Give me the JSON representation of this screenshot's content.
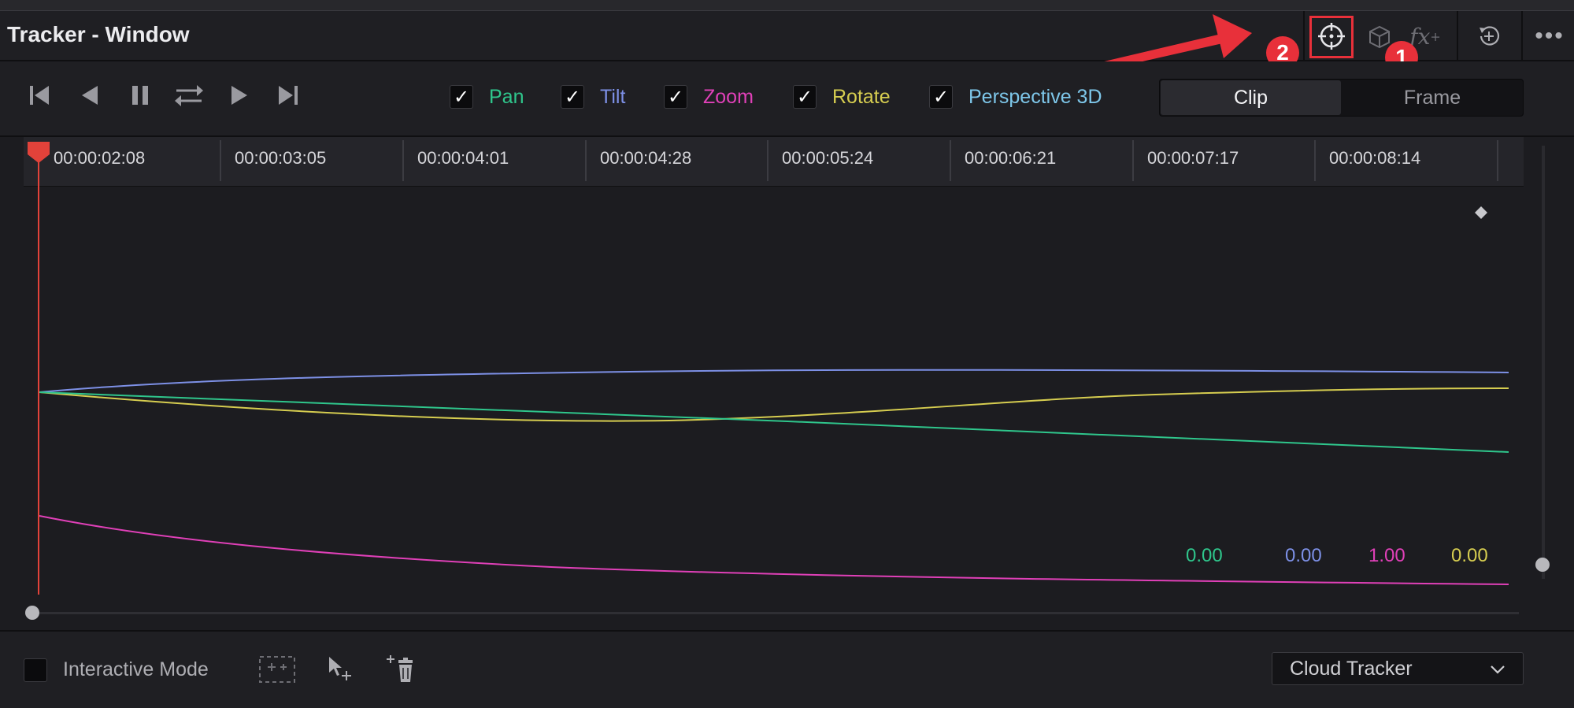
{
  "panel": {
    "title": "Tracker - Window"
  },
  "annotations": {
    "badge_1": "1",
    "badge_2": "2"
  },
  "icons": [
    "crosshair-tracker-icon",
    "cube-3d-icon",
    "fx-icon",
    "reset-icon",
    "more-options-icon",
    "go-to-start-icon",
    "step-back-icon",
    "pause-icon",
    "loop-icon",
    "play-icon",
    "go-to-end-icon",
    "add-tracker-point-icon",
    "select-tracker-point-icon",
    "delete-tracker-point-icon",
    "chevron-down-icon"
  ],
  "filters": [
    {
      "label": "Pan",
      "checked": true,
      "color": "#2fc68c"
    },
    {
      "label": "Tilt",
      "checked": true,
      "color": "#7d90e6"
    },
    {
      "label": "Zoom",
      "checked": true,
      "color": "#e040b8"
    },
    {
      "label": "Rotate",
      "checked": true,
      "color": "#d6cd50"
    },
    {
      "label": "Perspective 3D",
      "checked": true,
      "color": "#7ec7ea"
    }
  ],
  "mode_toggle": {
    "clip": "Clip",
    "frame": "Frame",
    "active": "Clip"
  },
  "timeline": {
    "ticks": [
      "00:00:02:08",
      "00:00:03:05",
      "00:00:04:01",
      "00:00:04:28",
      "00:00:05:24",
      "00:00:06:21",
      "00:00:07:17",
      "00:00:08:14"
    ],
    "playhead_color": "#e2423a"
  },
  "values": {
    "pan": "0.00",
    "tilt": "0.00",
    "zoom": "1.00",
    "rotate": "0.00"
  },
  "bottom": {
    "interactive_mode_label": "Interactive Mode",
    "interactive_mode_checked": false,
    "tracker_type": "Cloud Tracker"
  }
}
